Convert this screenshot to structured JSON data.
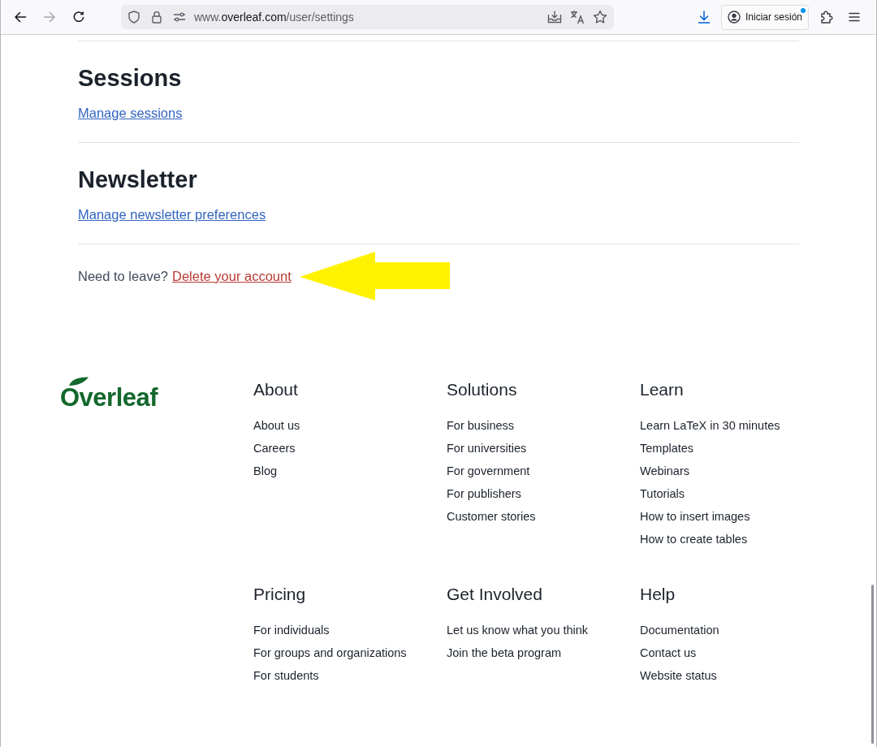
{
  "browser": {
    "nav_buttons": [
      {
        "kind": "back",
        "disabled": false
      },
      {
        "kind": "forward",
        "disabled": true
      },
      {
        "kind": "reload",
        "disabled": false
      }
    ],
    "address_bar": {
      "url_parts": [
        {
          "text": "www.",
          "kind": "dim"
        },
        {
          "text": "overleaf.com",
          "kind": "host"
        },
        {
          "text": "/user/settings",
          "kind": "dim"
        }
      ]
    },
    "sign_in_button": {
      "label": "Iniciar sesión",
      "notification": true
    }
  },
  "settings_sections": [
    {
      "title": "Sessions",
      "link": "Manage sessions"
    },
    {
      "title": "Newsletter",
      "link": "Manage newsletter preferences"
    }
  ],
  "delete_prompt": {
    "text": "Need to leave?",
    "link": "Delete your account"
  },
  "footer": {
    "logo": "Overleaf",
    "columns": [
      {
        "title": "About",
        "links": [
          "About us",
          "Careers",
          "Blog"
        ]
      },
      {
        "title": "Solutions",
        "links": [
          "For business",
          "For universities",
          "For government",
          "For publishers",
          "Customer stories"
        ]
      },
      {
        "title": "Learn",
        "links": [
          "Learn LaTeX in 30 minutes",
          "Templates",
          "Webinars",
          "Tutorials",
          "How to insert images",
          "How to create tables"
        ]
      },
      {
        "title": "Pricing",
        "links": [
          "For individuals",
          "For groups and organizations",
          "For students"
        ]
      },
      {
        "title": "Get Involved",
        "links": [
          "Let us know what you think",
          "Join the beta program"
        ]
      },
      {
        "title": "Help",
        "links": [
          "Documentation",
          "Contact us",
          "Website status"
        ]
      }
    ]
  }
}
